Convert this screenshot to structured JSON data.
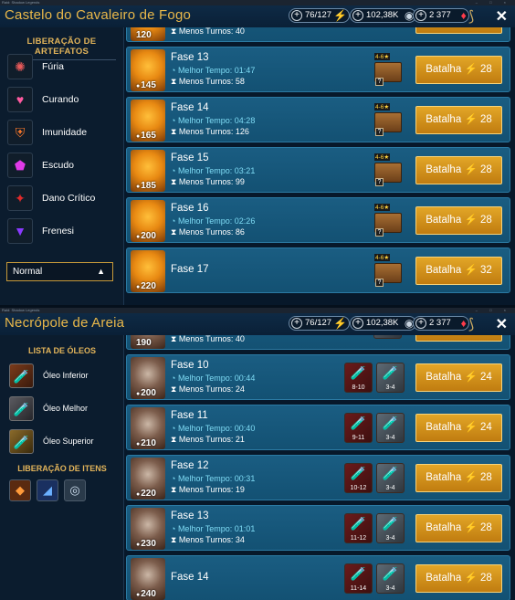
{
  "window": {
    "caption": "Raid: Shadow Legends"
  },
  "resources": {
    "energy": "76/127",
    "silver": "102,38K",
    "gems": "2 377"
  },
  "top": {
    "title": "Castelo do Cavaleiro de Fogo",
    "sidebar_heading": "LIBERAÇÃO DE ARTEFATOS",
    "sidebar_items": [
      {
        "label": "Fúria"
      },
      {
        "label": "Curando"
      },
      {
        "label": "Imunidade"
      },
      {
        "label": "Escudo"
      },
      {
        "label": "Dano Crítico"
      },
      {
        "label": "Frenesi"
      }
    ],
    "difficulty": "Normal",
    "partial_row": {
      "level": "120",
      "turns": "Menos Turnos: 40"
    },
    "rows": [
      {
        "stage": "Fase 13",
        "level": "145",
        "best": "Melhor Tempo: 01:47",
        "turns": "Menos Turnos: 58",
        "stars": "4-6★",
        "battle": "Batalha",
        "cost": "28"
      },
      {
        "stage": "Fase 14",
        "level": "165",
        "best": "Melhor Tempo: 04:28",
        "turns": "Menos Turnos: 126",
        "stars": "4-6★",
        "battle": "Batalha",
        "cost": "28"
      },
      {
        "stage": "Fase 15",
        "level": "185",
        "best": "Melhor Tempo: 03:21",
        "turns": "Menos Turnos: 99",
        "stars": "4-6★",
        "battle": "Batalha",
        "cost": "28"
      },
      {
        "stage": "Fase 16",
        "level": "200",
        "best": "Melhor Tempo: 02:26",
        "turns": "Menos Turnos: 86",
        "stars": "4-6★",
        "battle": "Batalha",
        "cost": "28"
      },
      {
        "stage": "Fase 17",
        "level": "220",
        "best": "",
        "turns": "",
        "stars": "4-6★",
        "battle": "Batalha",
        "cost": "32"
      }
    ]
  },
  "bottom": {
    "title": "Necrópole de Areia",
    "oil_heading": "LISTA DE ÓLEOS",
    "oils": [
      {
        "label": "Óleo Inferior"
      },
      {
        "label": "Óleo Melhor"
      },
      {
        "label": "Óleo Superior"
      }
    ],
    "items_heading": "LIBERAÇÃO DE ITENS",
    "partial_row": {
      "level": "190",
      "turns": "Menos Turnos: 40",
      "range": "8-9"
    },
    "rows": [
      {
        "stage": "Fase 10",
        "level": "200",
        "best": "Melhor Tempo: 00:44",
        "turns": "Menos Turnos: 24",
        "oil_range": "8-10",
        "drop_range": "3-4",
        "battle": "Batalha",
        "cost": "24"
      },
      {
        "stage": "Fase 11",
        "level": "210",
        "best": "Melhor Tempo: 00:40",
        "turns": "Menos Turnos: 21",
        "oil_range": "9-11",
        "drop_range": "3-4",
        "battle": "Batalha",
        "cost": "24"
      },
      {
        "stage": "Fase 12",
        "level": "220",
        "best": "Melhor Tempo: 00:31",
        "turns": "Menos Turnos: 19",
        "oil_range": "10-12",
        "drop_range": "3-4",
        "battle": "Batalha",
        "cost": "28"
      },
      {
        "stage": "Fase 13",
        "level": "230",
        "best": "Melhor Tempo: 01:01",
        "turns": "Menos Turnos: 34",
        "oil_range": "11-12",
        "drop_range": "3-4",
        "battle": "Batalha",
        "cost": "28"
      },
      {
        "stage": "Fase 14",
        "level": "240",
        "best": "",
        "turns": "",
        "oil_range": "11-14",
        "drop_range": "3-4",
        "battle": "Batalha",
        "cost": "28"
      }
    ]
  }
}
